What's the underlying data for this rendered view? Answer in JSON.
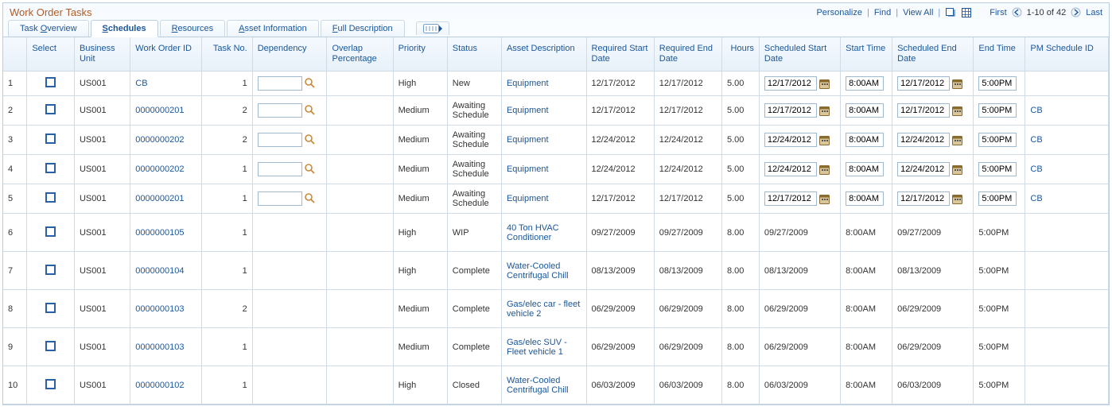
{
  "header": {
    "title": "Work Order Tasks",
    "personalize": "Personalize",
    "find": "Find",
    "view_all": "View All",
    "first": "First",
    "range": "1-10 of 42",
    "last": "Last"
  },
  "tabs": [
    {
      "label_pre": "Task ",
      "underline": "O",
      "label_post": "verview",
      "active": false
    },
    {
      "label_pre": "",
      "underline": "S",
      "label_post": "chedules",
      "active": true
    },
    {
      "label_pre": "",
      "underline": "R",
      "label_post": "esources",
      "active": false
    },
    {
      "label_pre": "",
      "underline": "A",
      "label_post": "sset Information",
      "active": false
    },
    {
      "label_pre": "",
      "underline": "F",
      "label_post": "ull Description",
      "active": false
    }
  ],
  "columns": {
    "select": "Select",
    "bu": "Business Unit",
    "wo": "Work Order ID",
    "task": "Task No.",
    "dep": "Dependency",
    "overlap": "Overlap Percentage",
    "priority": "Priority",
    "status": "Status",
    "asset": "Asset Description",
    "req_start": "Required Start Date",
    "req_end": "Required End Date",
    "hours": "Hours",
    "sched_start": "Scheduled Start Date",
    "start_time": "Start Time",
    "sched_end": "Scheduled End Date",
    "end_time": "End Time",
    "pm": "PM Schedule ID"
  },
  "rows": [
    {
      "idx": "1",
      "bu": "US001",
      "wo": "CB",
      "task": "1",
      "dep_editable": true,
      "dep": "",
      "overlap": "",
      "priority": "High",
      "status": "New",
      "asset": "Equipment",
      "req_start": "12/17/2012",
      "req_end": "12/17/2012",
      "hours": "5.00",
      "sched_editable": true,
      "sched_start": "12/17/2012",
      "start_time": "8:00AM",
      "sched_end": "12/17/2012",
      "end_time": "5:00PM",
      "pm": ""
    },
    {
      "idx": "2",
      "bu": "US001",
      "wo": "0000000201",
      "task": "2",
      "dep_editable": true,
      "dep": "",
      "overlap": "",
      "priority": "Medium",
      "status": "Awaiting Schedule",
      "asset": "Equipment",
      "req_start": "12/17/2012",
      "req_end": "12/17/2012",
      "hours": "5.00",
      "sched_editable": true,
      "sched_start": "12/17/2012",
      "start_time": "8:00AM",
      "sched_end": "12/17/2012",
      "end_time": "5:00PM",
      "pm": "CB"
    },
    {
      "idx": "3",
      "bu": "US001",
      "wo": "0000000202",
      "task": "2",
      "dep_editable": true,
      "dep": "",
      "overlap": "",
      "priority": "Medium",
      "status": "Awaiting Schedule",
      "asset": "Equipment",
      "req_start": "12/24/2012",
      "req_end": "12/24/2012",
      "hours": "5.00",
      "sched_editable": true,
      "sched_start": "12/24/2012",
      "start_time": "8:00AM",
      "sched_end": "12/24/2012",
      "end_time": "5:00PM",
      "pm": "CB"
    },
    {
      "idx": "4",
      "bu": "US001",
      "wo": "0000000202",
      "task": "1",
      "dep_editable": true,
      "dep": "",
      "overlap": "",
      "priority": "Medium",
      "status": "Awaiting Schedule",
      "asset": "Equipment",
      "req_start": "12/24/2012",
      "req_end": "12/24/2012",
      "hours": "5.00",
      "sched_editable": true,
      "sched_start": "12/24/2012",
      "start_time": "8:00AM",
      "sched_end": "12/24/2012",
      "end_time": "5:00PM",
      "pm": "CB"
    },
    {
      "idx": "5",
      "bu": "US001",
      "wo": "0000000201",
      "task": "1",
      "dep_editable": true,
      "dep": "",
      "overlap": "",
      "priority": "Medium",
      "status": "Awaiting Schedule",
      "asset": "Equipment",
      "req_start": "12/17/2012",
      "req_end": "12/17/2012",
      "hours": "5.00",
      "sched_editable": true,
      "sched_start": "12/17/2012",
      "start_time": "8:00AM",
      "sched_end": "12/17/2012",
      "end_time": "5:00PM",
      "pm": "CB"
    },
    {
      "idx": "6",
      "bu": "US001",
      "wo": "0000000105",
      "task": "1",
      "dep_editable": false,
      "dep": "",
      "overlap": "",
      "priority": "High",
      "status": "WIP",
      "asset": "40 Ton HVAC Conditioner",
      "req_start": "09/27/2009",
      "req_end": "09/27/2009",
      "hours": "8.00",
      "sched_editable": false,
      "sched_start": "09/27/2009",
      "start_time": "8:00AM",
      "sched_end": "09/27/2009",
      "end_time": "5:00PM",
      "pm": ""
    },
    {
      "idx": "7",
      "bu": "US001",
      "wo": "0000000104",
      "task": "1",
      "dep_editable": false,
      "dep": "",
      "overlap": "",
      "priority": "High",
      "status": "Complete",
      "asset": "Water-Cooled Centrifugal Chill",
      "req_start": "08/13/2009",
      "req_end": "08/13/2009",
      "hours": "8.00",
      "sched_editable": false,
      "sched_start": "08/13/2009",
      "start_time": "8:00AM",
      "sched_end": "08/13/2009",
      "end_time": "5:00PM",
      "pm": ""
    },
    {
      "idx": "8",
      "bu": "US001",
      "wo": "0000000103",
      "task": "2",
      "dep_editable": false,
      "dep": "",
      "overlap": "",
      "priority": "Medium",
      "status": "Complete",
      "asset": "Gas/elec car - fleet vehicle 2",
      "req_start": "06/29/2009",
      "req_end": "06/29/2009",
      "hours": "8.00",
      "sched_editable": false,
      "sched_start": "06/29/2009",
      "start_time": "8:00AM",
      "sched_end": "06/29/2009",
      "end_time": "5:00PM",
      "pm": ""
    },
    {
      "idx": "9",
      "bu": "US001",
      "wo": "0000000103",
      "task": "1",
      "dep_editable": false,
      "dep": "",
      "overlap": "",
      "priority": "Medium",
      "status": "Complete",
      "asset": "Gas/elec SUV - Fleet vehicle 1",
      "req_start": "06/29/2009",
      "req_end": "06/29/2009",
      "hours": "8.00",
      "sched_editable": false,
      "sched_start": "06/29/2009",
      "start_time": "8:00AM",
      "sched_end": "06/29/2009",
      "end_time": "5:00PM",
      "pm": ""
    },
    {
      "idx": "10",
      "bu": "US001",
      "wo": "0000000102",
      "task": "1",
      "dep_editable": false,
      "dep": "",
      "overlap": "",
      "priority": "High",
      "status": "Closed",
      "asset": "Water-Cooled Centrifugal Chill",
      "req_start": "06/03/2009",
      "req_end": "06/03/2009",
      "hours": "8.00",
      "sched_editable": false,
      "sched_start": "06/03/2009",
      "start_time": "8:00AM",
      "sched_end": "06/03/2009",
      "end_time": "5:00PM",
      "pm": ""
    }
  ]
}
